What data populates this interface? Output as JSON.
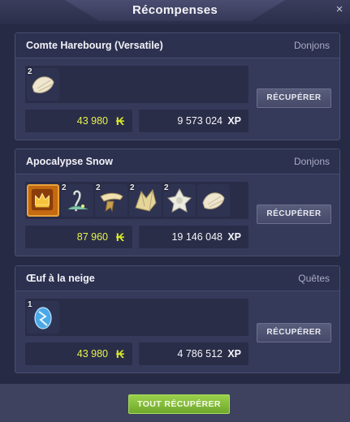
{
  "window": {
    "title": "Récompenses",
    "close": "×"
  },
  "rewards": [
    {
      "name": "Comte Harebourg (Versatile)",
      "type": "Donjons",
      "items": [
        {
          "qty": "2",
          "icon": "shell-icon"
        }
      ],
      "kamas": "43 980",
      "xp": "9 573 024",
      "button": "RÉCUPÉRER"
    },
    {
      "name": "Apocalypse Snow",
      "type": "Donjons",
      "items": [
        {
          "qty": "",
          "icon": "crown-icon"
        },
        {
          "qty": "2",
          "icon": "plant-icon"
        },
        {
          "qty": "2",
          "icon": "horn-icon"
        },
        {
          "qty": "2",
          "icon": "crystal-shard-icon"
        },
        {
          "qty": "2",
          "icon": "ice-crystal-icon"
        },
        {
          "qty": "",
          "icon": "shell-icon"
        }
      ],
      "kamas": "87 960",
      "xp": "19 146 048",
      "button": "RÉCUPÉRER"
    },
    {
      "name": "Œuf à la neige",
      "type": "Quêtes",
      "items": [
        {
          "qty": "1",
          "icon": "frost-egg-icon"
        }
      ],
      "kamas": "43 980",
      "xp": "4 786 512",
      "button": "RÉCUPÉRER"
    }
  ],
  "labels": {
    "xp": "XP",
    "kamas_symbol": "₭"
  },
  "footer": {
    "all_button": "TOUT RÉCUPÉRER"
  },
  "colors": {
    "kamas": "#e6f24e",
    "accept": "#8cc63f",
    "panel": "#363a5a"
  }
}
